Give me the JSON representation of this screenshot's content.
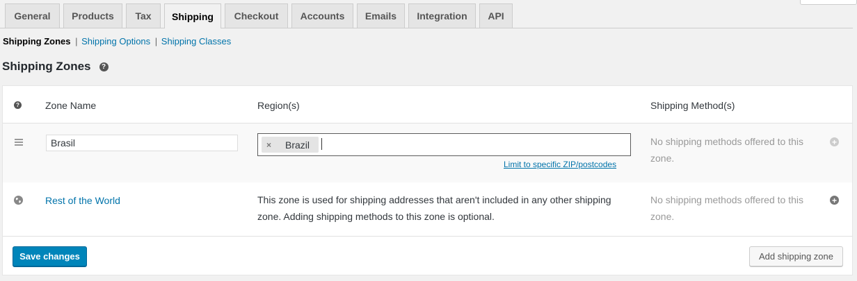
{
  "tabs": [
    {
      "label": "General"
    },
    {
      "label": "Products"
    },
    {
      "label": "Tax"
    },
    {
      "label": "Shipping",
      "active": true
    },
    {
      "label": "Checkout"
    },
    {
      "label": "Accounts"
    },
    {
      "label": "Emails"
    },
    {
      "label": "Integration"
    },
    {
      "label": "API"
    }
  ],
  "subnav": {
    "current": "Shipping Zones",
    "links": [
      "Shipping Options",
      "Shipping Classes"
    ],
    "separator": "|"
  },
  "page_title": "Shipping Zones",
  "help_icon": "?",
  "table": {
    "headers": {
      "zone_name": "Zone Name",
      "regions": "Region(s)",
      "methods": "Shipping Method(s)"
    },
    "zone_row": {
      "zone_name_value": "Brasil",
      "region_chip": "Brazil",
      "chip_remove": "×",
      "limit_link": "Limit to specific ZIP/postcodes",
      "methods_text": "No shipping methods offered to this zone.",
      "add_method_icon": "+"
    },
    "rest_row": {
      "name": "Rest of the World",
      "description": "This zone is used for shipping addresses that aren't included in any other shipping zone. Adding shipping methods to this zone is optional.",
      "methods_text": "No shipping methods offered to this zone.",
      "add_method_icon": "+"
    }
  },
  "buttons": {
    "save": "Save changes",
    "add_zone": "Add shipping zone"
  },
  "colors": {
    "link": "#0073aa",
    "primary": "#0085ba",
    "muted": "#999999"
  }
}
